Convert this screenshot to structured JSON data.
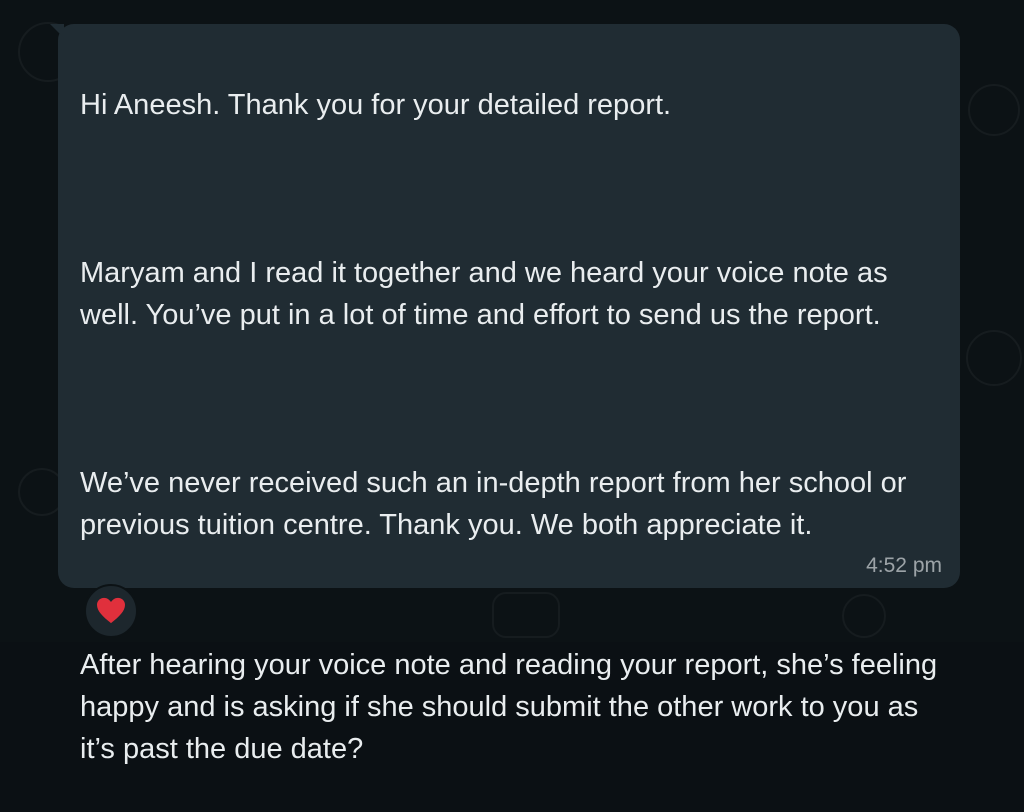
{
  "message": {
    "paragraph_1": "Hi Aneesh. Thank you for your detailed report.",
    "paragraph_2": "Maryam and I read it together and we heard your voice note as well. You’ve put in a lot of time and effort to send us the report.",
    "paragraph_3": "We’ve never received such an in-depth report from her school or previous tuition centre. Thank you. We both appreciate it.",
    "paragraph_4": "After hearing your voice note and reading your report, she’s feeling happy and is asking if she should submit the other work to you as it’s past the due date?",
    "timestamp": "4:52 pm"
  },
  "reaction": {
    "icon": "heart-icon",
    "color": "#e0303c"
  },
  "colors": {
    "bubble_background": "#202c33",
    "chat_background": "#0c1215",
    "text": "#e9edef"
  }
}
